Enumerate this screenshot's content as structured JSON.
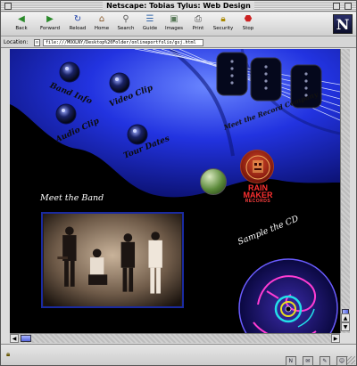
{
  "window": {
    "title": "Netscape: Tobias Tylus: Web Design"
  },
  "toolbar": {
    "buttons": [
      {
        "label": "Back",
        "icon": "back-arrow-icon"
      },
      {
        "label": "Forward",
        "icon": "forward-arrow-icon"
      },
      {
        "label": "Reload",
        "icon": "reload-icon"
      },
      {
        "label": "Home",
        "icon": "home-icon"
      },
      {
        "label": "Search",
        "icon": "search-icon"
      },
      {
        "label": "Guide",
        "icon": "guide-icon"
      },
      {
        "label": "Images",
        "icon": "images-icon"
      },
      {
        "label": "Print",
        "icon": "print-icon"
      },
      {
        "label": "Security",
        "icon": "security-lock-icon"
      },
      {
        "label": "Stop",
        "icon": "stop-icon"
      }
    ],
    "brand_letter": "N"
  },
  "location": {
    "label": "Location:",
    "url": "file:///MOOLNY/Desktop%20Folder/onlineportfolio/gsj.html"
  },
  "page": {
    "guitar_links": {
      "band_info": "Band Info",
      "video_clip": "Video Clip",
      "audio_clip": "Audio Clip",
      "tour_dates": "Tour Dates"
    },
    "meet_record_company": "Meet the Record Company",
    "meet_band_heading": "Meet the Band",
    "sample_cd_heading": "Sample the CD",
    "record_label": {
      "name_line1": "RAIN",
      "name_line2": "MAKER",
      "sub": "RECORDS"
    }
  },
  "colors": {
    "guitar_blue": "#1e2fd8",
    "page_background": "#000000",
    "record_label_red": "#ff3030",
    "photo_frame": "#1a2aa0"
  }
}
